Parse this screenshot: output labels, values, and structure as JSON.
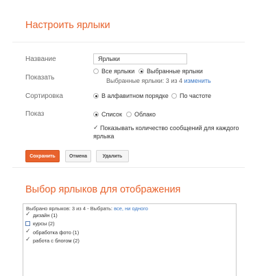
{
  "header": {
    "title": "Настроить ярлыки"
  },
  "form": {
    "name": {
      "label": "Название",
      "value": "Ярлыки"
    },
    "show": {
      "label": "Показать",
      "options": [
        "Все ярлыки",
        "Выбранные ярлыки"
      ],
      "selected": "Выбранные ярлыки",
      "summary": "Выбранные ярлыки: 3 из 4",
      "change_link": "изменить"
    },
    "sort": {
      "label": "Сортировка",
      "options": [
        "В алфавитном порядке",
        "По частоте"
      ],
      "selected": "В алфавитном порядке"
    },
    "display": {
      "label": "Показ",
      "options": [
        "Список",
        "Облако"
      ],
      "selected": "Список",
      "count_checkbox": {
        "line1": "Показывать количество сообщений для каждого",
        "line2": "ярлыка",
        "checked": true
      }
    }
  },
  "buttons": {
    "save": "Сохранить",
    "cancel": "Отмена",
    "delete": "Удалить"
  },
  "selection": {
    "title": "Выбор ярлыков для отображения",
    "header_prefix": "Выбрано ярлыков: 3 из 4 - Выбрать:",
    "all_link": "все,",
    "none_link": "ни одного",
    "items": [
      {
        "label": "дизайн (1)",
        "checked": true
      },
      {
        "label": "курсы (2)",
        "checked": false
      },
      {
        "label": "обработка фото (1)",
        "checked": true
      },
      {
        "label": "работа с блогом (2)",
        "checked": true
      }
    ]
  },
  "colors": {
    "accent": "#e8622c",
    "link": "#3a77c6",
    "checkbox_border": "#5a7fb5"
  }
}
